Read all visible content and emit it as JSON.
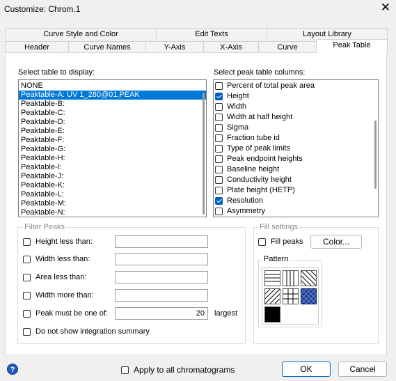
{
  "window": {
    "title": "Customize: Chrom.1",
    "close_glyph": "✕"
  },
  "tabs": {
    "row1": [
      "Curve Style and Color",
      "Edit Texts",
      "Layout Library"
    ],
    "row2": [
      "Header",
      "Curve Names",
      "Y-Axis",
      "X-Axis",
      "Curve",
      "Peak Table"
    ],
    "active": "Peak Table"
  },
  "table_select": {
    "label": "Select table to display:",
    "items": [
      "NONE",
      "Peaktable-A: UV 1_280@01,PEAK",
      "Peaktable-B:",
      "Peaktable-C:",
      "Peaktable-D:",
      "Peaktable-E:",
      "Peaktable-F:",
      "Peaktable-G:",
      "Peaktable-H:",
      "Peaktable-I:",
      "Peaktable-J:",
      "Peaktable-K:",
      "Peaktable-L:",
      "Peaktable-M:",
      "Peaktable-N:"
    ],
    "selected_index": 1
  },
  "columns_select": {
    "label": "Select peak table columns:",
    "items": [
      {
        "label": "Percent of total peak area",
        "checked": false
      },
      {
        "label": "Height",
        "checked": true
      },
      {
        "label": "Width",
        "checked": false
      },
      {
        "label": "Width at half height",
        "checked": false
      },
      {
        "label": "Sigma",
        "checked": false
      },
      {
        "label": "Fraction tube id",
        "checked": false
      },
      {
        "label": "Type of peak limits",
        "checked": false
      },
      {
        "label": "Peak endpoint heights",
        "checked": false
      },
      {
        "label": "Baseline height",
        "checked": false
      },
      {
        "label": "Conductivity height",
        "checked": false
      },
      {
        "label": "Plate height (HETP)",
        "checked": false
      },
      {
        "label": "Resolution",
        "checked": true
      },
      {
        "label": "Asymmetry",
        "checked": false
      }
    ]
  },
  "filter_peaks": {
    "title": "Filter Peaks",
    "height_less": "Height less than:",
    "width_less": "Width less than:",
    "area_less": "Area less than:",
    "width_more": "Width more than:",
    "peak_one_of": "Peak must be one of:",
    "peak_value": "20",
    "largest": "largest",
    "no_summary": "Do not show integration summary"
  },
  "fill_settings": {
    "title": "Fill settings",
    "fill_peaks": "Fill peaks",
    "color_button": "Color...",
    "pattern_title": "Pattern"
  },
  "footer": {
    "help": "?",
    "apply_all": "Apply to all chromatograms",
    "ok": "OK",
    "cancel": "Cancel"
  }
}
